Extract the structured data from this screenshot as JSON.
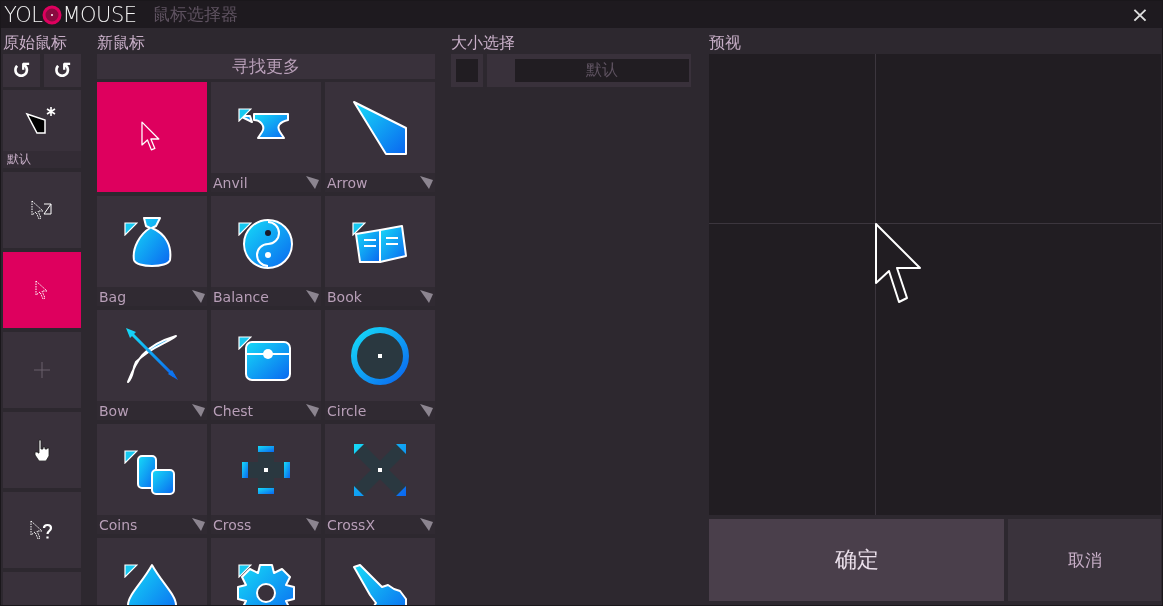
{
  "window": {
    "logo_left": "YOL",
    "logo_right": "MOUSE",
    "title": "鼠标选择器",
    "close": "×"
  },
  "original": {
    "heading": "原始鼠标",
    "undo": "↺",
    "redo": "↺",
    "cursors": [
      {
        "kind": "default",
        "label": "默认",
        "selected": false
      },
      {
        "kind": "working",
        "selected": false
      },
      {
        "kind": "pointer",
        "selected": true
      },
      {
        "kind": "plus",
        "selected": false
      },
      {
        "kind": "hand",
        "selected": false
      },
      {
        "kind": "help",
        "selected": false
      },
      {
        "kind": "blank",
        "selected": false
      }
    ]
  },
  "new": {
    "heading": "新鼠标",
    "find_more": "寻找更多",
    "tiles": [
      {
        "kind": "pointer",
        "selected": true,
        "marked": false
      },
      {
        "kind": "anvil",
        "label": "Anvil",
        "selected": false,
        "marked": true
      },
      {
        "kind": "arrow",
        "label": "Arrow",
        "selected": false,
        "marked": false
      },
      {
        "kind": "bag",
        "label": "Bag",
        "selected": false,
        "marked": true
      },
      {
        "kind": "balance",
        "label": "Balance",
        "selected": false,
        "marked": true
      },
      {
        "kind": "book",
        "label": "Book",
        "selected": false,
        "marked": true
      },
      {
        "kind": "bow",
        "label": "Bow",
        "selected": false,
        "marked": false
      },
      {
        "kind": "chest",
        "label": "Chest",
        "selected": false,
        "marked": true
      },
      {
        "kind": "circle",
        "label": "Circle",
        "selected": false,
        "marked": false
      },
      {
        "kind": "coins",
        "label": "Coins",
        "selected": false,
        "marked": true
      },
      {
        "kind": "cross",
        "label": "Cross",
        "selected": false,
        "marked": false
      },
      {
        "kind": "crossx",
        "label": "CrossX",
        "selected": false,
        "marked": false
      },
      {
        "kind": "drop",
        "selected": false,
        "marked": true
      },
      {
        "kind": "gear",
        "selected": false,
        "marked": true
      },
      {
        "kind": "hand",
        "selected": false,
        "marked": false
      }
    ]
  },
  "size": {
    "heading": "大小选择",
    "value": "默认"
  },
  "preview": {
    "heading": "预视"
  },
  "buttons": {
    "confirm": "确定",
    "cancel": "取消"
  }
}
